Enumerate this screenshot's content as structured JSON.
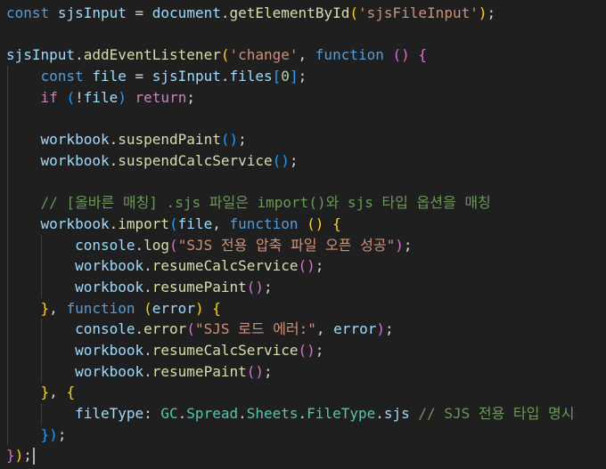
{
  "theme": {
    "background": "#1f1f1f",
    "keyword": "#569cd6",
    "control": "#c586c0",
    "variable": "#9cdcfe",
    "function": "#dcdcaa",
    "string": "#ce9178",
    "number": "#b5cea8",
    "class": "#4ec9b0",
    "comment": "#6a9955",
    "bracket_1": "#ffd700",
    "bracket_2": "#da70d6",
    "bracket_3": "#179fff"
  },
  "lines": [
    {
      "indent": 0,
      "tokens": [
        {
          "t": "kw",
          "v": "const"
        },
        {
          "t": "pun",
          "v": " "
        },
        {
          "t": "var",
          "v": "sjsInput"
        },
        {
          "t": "pun",
          "v": " = "
        },
        {
          "t": "var",
          "v": "document"
        },
        {
          "t": "pun",
          "v": "."
        },
        {
          "t": "fn",
          "v": "getElementById"
        },
        {
          "t": "b1",
          "v": "("
        },
        {
          "t": "str",
          "v": "'sjsFileInput'"
        },
        {
          "t": "b1",
          "v": ")"
        },
        {
          "t": "pun",
          "v": ";"
        }
      ]
    },
    {
      "indent": 0,
      "tokens": []
    },
    {
      "indent": 0,
      "tokens": [
        {
          "t": "var",
          "v": "sjsInput"
        },
        {
          "t": "pun",
          "v": "."
        },
        {
          "t": "fn",
          "v": "addEventListener"
        },
        {
          "t": "b1",
          "v": "("
        },
        {
          "t": "str",
          "v": "'change'"
        },
        {
          "t": "pun",
          "v": ", "
        },
        {
          "t": "kw",
          "v": "function"
        },
        {
          "t": "pun",
          "v": " "
        },
        {
          "t": "b2",
          "v": "()"
        },
        {
          "t": "pun",
          "v": " "
        },
        {
          "t": "b2",
          "v": "{"
        }
      ]
    },
    {
      "indent": 1,
      "tokens": [
        {
          "t": "kw",
          "v": "const"
        },
        {
          "t": "pun",
          "v": " "
        },
        {
          "t": "var",
          "v": "file"
        },
        {
          "t": "pun",
          "v": " = "
        },
        {
          "t": "var",
          "v": "sjsInput"
        },
        {
          "t": "pun",
          "v": "."
        },
        {
          "t": "var",
          "v": "files"
        },
        {
          "t": "b3",
          "v": "["
        },
        {
          "t": "num",
          "v": "0"
        },
        {
          "t": "b3",
          "v": "]"
        },
        {
          "t": "pun",
          "v": ";"
        }
      ]
    },
    {
      "indent": 1,
      "tokens": [
        {
          "t": "ctrl",
          "v": "if"
        },
        {
          "t": "pun",
          "v": " "
        },
        {
          "t": "b3",
          "v": "("
        },
        {
          "t": "pun",
          "v": "!"
        },
        {
          "t": "var",
          "v": "file"
        },
        {
          "t": "b3",
          "v": ")"
        },
        {
          "t": "pun",
          "v": " "
        },
        {
          "t": "ctrl",
          "v": "return"
        },
        {
          "t": "pun",
          "v": ";"
        }
      ]
    },
    {
      "indent": 1,
      "tokens": []
    },
    {
      "indent": 1,
      "tokens": [
        {
          "t": "var",
          "v": "workbook"
        },
        {
          "t": "pun",
          "v": "."
        },
        {
          "t": "fn",
          "v": "suspendPaint"
        },
        {
          "t": "b3",
          "v": "()"
        },
        {
          "t": "pun",
          "v": ";"
        }
      ]
    },
    {
      "indent": 1,
      "tokens": [
        {
          "t": "var",
          "v": "workbook"
        },
        {
          "t": "pun",
          "v": "."
        },
        {
          "t": "fn",
          "v": "suspendCalcService"
        },
        {
          "t": "b3",
          "v": "()"
        },
        {
          "t": "pun",
          "v": ";"
        }
      ]
    },
    {
      "indent": 1,
      "tokens": []
    },
    {
      "indent": 1,
      "tokens": [
        {
          "t": "cmt",
          "v": "// [올바른 매칭] .sjs 파일은 import()와 sjs 타입 옵션을 매칭"
        }
      ]
    },
    {
      "indent": 1,
      "tokens": [
        {
          "t": "var",
          "v": "workbook"
        },
        {
          "t": "pun",
          "v": "."
        },
        {
          "t": "fn",
          "v": "import"
        },
        {
          "t": "b3",
          "v": "("
        },
        {
          "t": "var",
          "v": "file"
        },
        {
          "t": "pun",
          "v": ", "
        },
        {
          "t": "kw",
          "v": "function"
        },
        {
          "t": "pun",
          "v": " "
        },
        {
          "t": "b1",
          "v": "()"
        },
        {
          "t": "pun",
          "v": " "
        },
        {
          "t": "b1",
          "v": "{"
        }
      ]
    },
    {
      "indent": 2,
      "tokens": [
        {
          "t": "var",
          "v": "console"
        },
        {
          "t": "pun",
          "v": "."
        },
        {
          "t": "fn",
          "v": "log"
        },
        {
          "t": "b2",
          "v": "("
        },
        {
          "t": "str",
          "v": "\"SJS 전용 압축 파일 오픈 성공\""
        },
        {
          "t": "b2",
          "v": ")"
        },
        {
          "t": "pun",
          "v": ";"
        }
      ]
    },
    {
      "indent": 2,
      "tokens": [
        {
          "t": "var",
          "v": "workbook"
        },
        {
          "t": "pun",
          "v": "."
        },
        {
          "t": "fn",
          "v": "resumeCalcService"
        },
        {
          "t": "b2",
          "v": "()"
        },
        {
          "t": "pun",
          "v": ";"
        }
      ]
    },
    {
      "indent": 2,
      "tokens": [
        {
          "t": "var",
          "v": "workbook"
        },
        {
          "t": "pun",
          "v": "."
        },
        {
          "t": "fn",
          "v": "resumePaint"
        },
        {
          "t": "b2",
          "v": "()"
        },
        {
          "t": "pun",
          "v": ";"
        }
      ]
    },
    {
      "indent": 1,
      "tokens": [
        {
          "t": "b1",
          "v": "}"
        },
        {
          "t": "pun",
          "v": ", "
        },
        {
          "t": "kw",
          "v": "function"
        },
        {
          "t": "pun",
          "v": " "
        },
        {
          "t": "b1",
          "v": "("
        },
        {
          "t": "var",
          "v": "error"
        },
        {
          "t": "b1",
          "v": ")"
        },
        {
          "t": "pun",
          "v": " "
        },
        {
          "t": "b1",
          "v": "{"
        }
      ]
    },
    {
      "indent": 2,
      "tokens": [
        {
          "t": "var",
          "v": "console"
        },
        {
          "t": "pun",
          "v": "."
        },
        {
          "t": "fn",
          "v": "error"
        },
        {
          "t": "b2",
          "v": "("
        },
        {
          "t": "str",
          "v": "\"SJS 로드 에러:\""
        },
        {
          "t": "pun",
          "v": ", "
        },
        {
          "t": "var",
          "v": "error"
        },
        {
          "t": "b2",
          "v": ")"
        },
        {
          "t": "pun",
          "v": ";"
        }
      ]
    },
    {
      "indent": 2,
      "tokens": [
        {
          "t": "var",
          "v": "workbook"
        },
        {
          "t": "pun",
          "v": "."
        },
        {
          "t": "fn",
          "v": "resumeCalcService"
        },
        {
          "t": "b2",
          "v": "()"
        },
        {
          "t": "pun",
          "v": ";"
        }
      ]
    },
    {
      "indent": 2,
      "tokens": [
        {
          "t": "var",
          "v": "workbook"
        },
        {
          "t": "pun",
          "v": "."
        },
        {
          "t": "fn",
          "v": "resumePaint"
        },
        {
          "t": "b2",
          "v": "()"
        },
        {
          "t": "pun",
          "v": ";"
        }
      ]
    },
    {
      "indent": 1,
      "tokens": [
        {
          "t": "b1",
          "v": "}"
        },
        {
          "t": "pun",
          "v": ", "
        },
        {
          "t": "b1",
          "v": "{"
        }
      ]
    },
    {
      "indent": 2,
      "tokens": [
        {
          "t": "var",
          "v": "fileType"
        },
        {
          "t": "pun",
          "v": ": "
        },
        {
          "t": "cls",
          "v": "GC"
        },
        {
          "t": "pun",
          "v": "."
        },
        {
          "t": "cls",
          "v": "Spread"
        },
        {
          "t": "pun",
          "v": "."
        },
        {
          "t": "cls",
          "v": "Sheets"
        },
        {
          "t": "pun",
          "v": "."
        },
        {
          "t": "cls",
          "v": "FileType"
        },
        {
          "t": "pun",
          "v": "."
        },
        {
          "t": "var",
          "v": "sjs"
        },
        {
          "t": "pun",
          "v": " "
        },
        {
          "t": "cmt",
          "v": "// SJS 전용 타입 명시"
        }
      ]
    },
    {
      "indent": 1,
      "tokens": [
        {
          "t": "b3",
          "v": "}"
        },
        {
          "t": "b3",
          "v": ")"
        },
        {
          "t": "pun",
          "v": ";"
        }
      ]
    },
    {
      "indent": 0,
      "cursor": true,
      "tokens": [
        {
          "t": "b2",
          "v": "}"
        },
        {
          "t": "b1",
          "v": ")"
        },
        {
          "t": "pun",
          "v": ";"
        }
      ]
    }
  ]
}
